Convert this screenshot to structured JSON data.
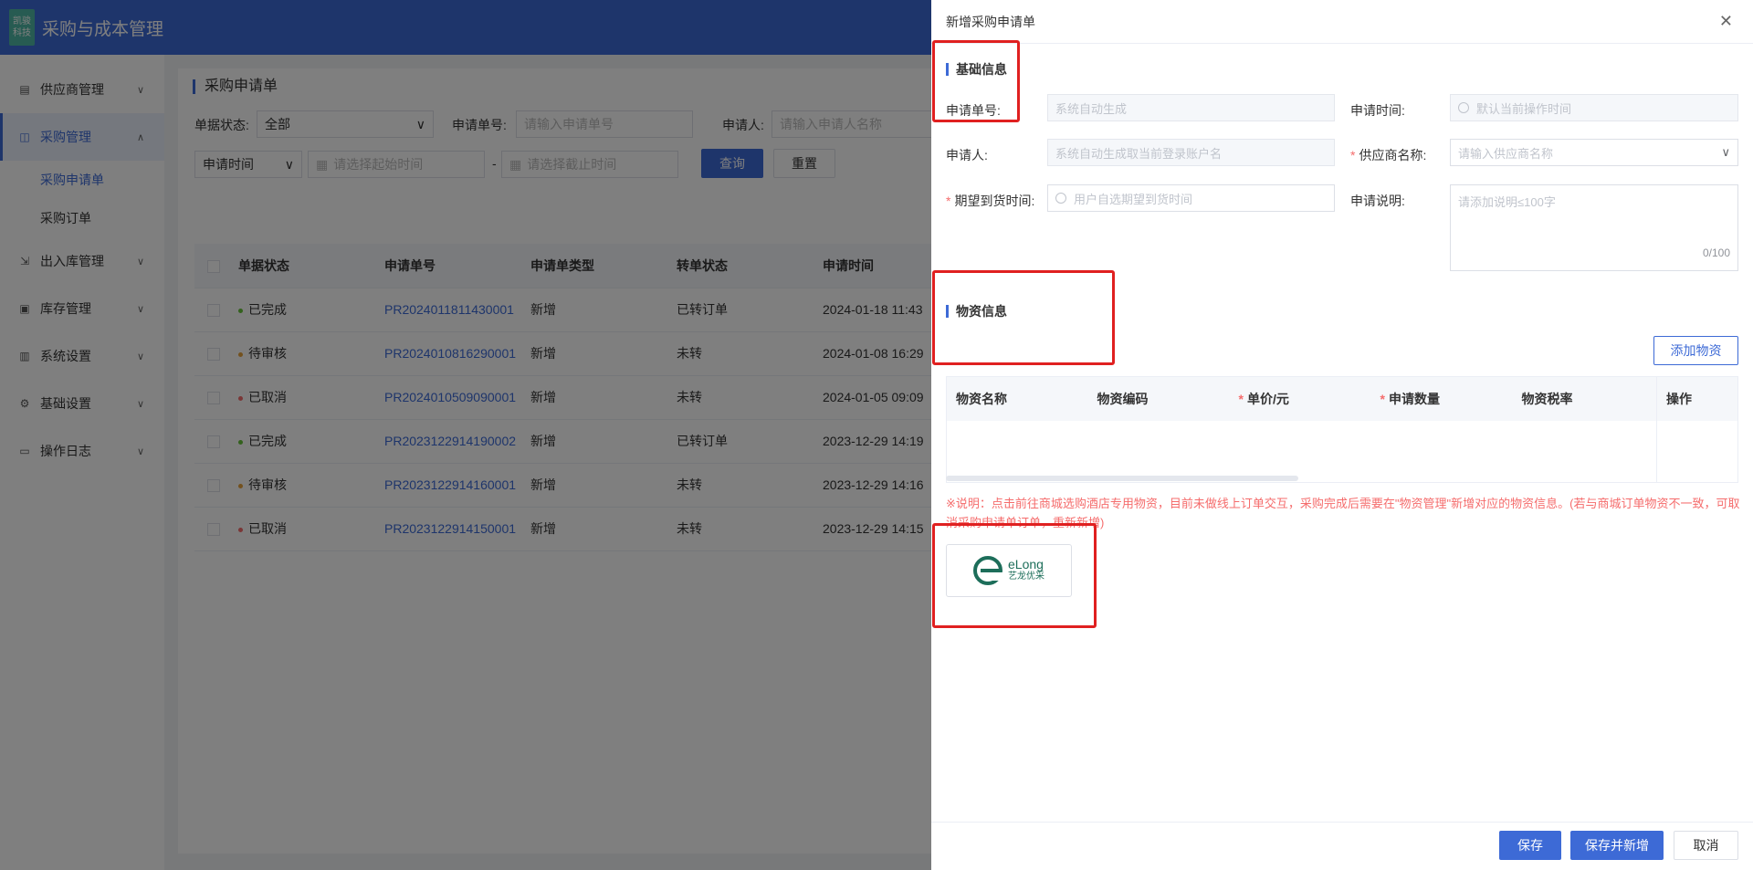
{
  "header": {
    "logo_line1": "凯骏",
    "logo_line2": "科技",
    "title": "采购与成本管理"
  },
  "sidebar": {
    "items": [
      {
        "label": "供应商管理",
        "icon": "supplier-icon"
      },
      {
        "label": "采购管理",
        "icon": "cart-icon"
      },
      {
        "label": "出入库管理",
        "icon": "inout-icon"
      },
      {
        "label": "库存管理",
        "icon": "inventory-icon"
      },
      {
        "label": "系统设置",
        "icon": "settings-icon"
      },
      {
        "label": "基础设置",
        "icon": "gear-icon"
      },
      {
        "label": "操作日志",
        "icon": "log-icon"
      }
    ],
    "sub_items": [
      {
        "label": "采购申请单"
      },
      {
        "label": "采购订单"
      }
    ]
  },
  "main": {
    "title": "采购申请单",
    "filters": {
      "status_label": "单据状态:",
      "status_value": "全部",
      "no_label": "申请单号:",
      "no_placeholder": "请输入申请单号",
      "applicant_label": "申请人:",
      "applicant_placeholder": "请输入申请人名称",
      "time_type": "申请时间",
      "start_placeholder": "请选择起始时间",
      "sep": "-",
      "end_placeholder": "请选择截止时间",
      "query": "查询",
      "reset": "重置"
    },
    "table": {
      "headers": [
        "单据状态",
        "申请单号",
        "申请单类型",
        "转单状态",
        "申请时间"
      ],
      "rows": [
        {
          "status": "已完成",
          "status_color": "#67c23a",
          "no": "PR2024011811430001",
          "type": "新增",
          "convert": "已转订单",
          "time": "2024-01-18 11:43"
        },
        {
          "status": "待审核",
          "status_color": "#e6a23c",
          "no": "PR2024010816290001",
          "type": "新增",
          "convert": "未转",
          "time": "2024-01-08 16:29"
        },
        {
          "status": "已取消",
          "status_color": "#f56c6c",
          "no": "PR2024010509090001",
          "type": "新增",
          "convert": "未转",
          "time": "2024-01-05 09:09"
        },
        {
          "status": "已完成",
          "status_color": "#67c23a",
          "no": "PR2023122914190002",
          "type": "新增",
          "convert": "已转订单",
          "time": "2023-12-29 14:19"
        },
        {
          "status": "待审核",
          "status_color": "#e6a23c",
          "no": "PR2023122914160001",
          "type": "新增",
          "convert": "未转",
          "time": "2023-12-29 14:16"
        },
        {
          "status": "已取消",
          "status_color": "#f56c6c",
          "no": "PR2023122914150001",
          "type": "新增",
          "convert": "未转",
          "time": "2023-12-29 14:15"
        }
      ]
    }
  },
  "drawer": {
    "title": "新增采购申请单",
    "basic_section": "基础信息",
    "fields": {
      "no_label": "申请单号:",
      "no_placeholder": "系统自动生成",
      "time_label": "申请时间:",
      "time_placeholder": "默认当前操作时间",
      "applicant_label": "申请人:",
      "applicant_placeholder": "系统自动生成取当前登录账户名",
      "supplier_label": "供应商名称:",
      "supplier_placeholder": "请输入供应商名称",
      "expect_label": "期望到货时间:",
      "expect_placeholder": "用户自选期望到货时间",
      "desc_label": "申请说明:",
      "desc_placeholder": "请添加说明≤100字",
      "desc_counter": "0/100",
      "required_mark": "*"
    },
    "material_section": "物资信息",
    "add_material": "添加物资",
    "material_headers": [
      "物资名称",
      "物资编码",
      "单价/元",
      "申请数量",
      "物资税率",
      "操作"
    ],
    "note": "※说明：点击前往商城选购酒店专用物资，目前未做线上订单交互，采购完成后需要在\"物资管理\"新增对应的物资信息。(若与商城订单物资不一致，可取消采购申请单订单，重新新增)",
    "elong": {
      "en": "eLong",
      "cn": "艺龙优采"
    },
    "footer": {
      "save": "保存",
      "save_new": "保存并新增",
      "cancel": "取消"
    }
  }
}
